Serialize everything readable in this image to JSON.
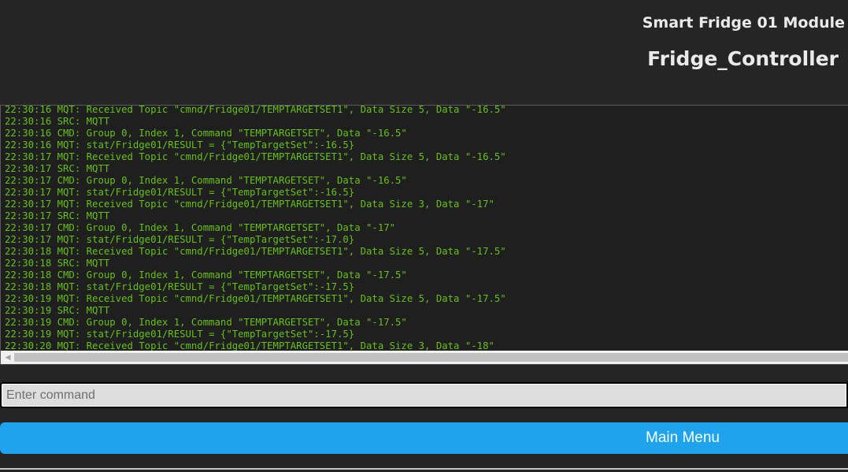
{
  "header": {
    "module_name": "Smart Fridge 01 Module",
    "device_name": "Fridge_Controller"
  },
  "console": {
    "lines": [
      "22:30:16 MQT: Received Topic \"cmnd/Fridge01/TEMPTARGETSET1\", Data Size 5, Data \"-16.5\"",
      "22:30:16 SRC: MQTT",
      "22:30:16 CMD: Group 0, Index 1, Command \"TEMPTARGETSET\", Data \"-16.5\"",
      "22:30:16 MQT: stat/Fridge01/RESULT = {\"TempTargetSet\":-16.5}",
      "22:30:17 MQT: Received Topic \"cmnd/Fridge01/TEMPTARGETSET1\", Data Size 5, Data \"-16.5\"",
      "22:30:17 SRC: MQTT",
      "22:30:17 CMD: Group 0, Index 1, Command \"TEMPTARGETSET\", Data \"-16.5\"",
      "22:30:17 MQT: stat/Fridge01/RESULT = {\"TempTargetSet\":-16.5}",
      "22:30:17 MQT: Received Topic \"cmnd/Fridge01/TEMPTARGETSET1\", Data Size 3, Data \"-17\"",
      "22:30:17 SRC: MQTT",
      "22:30:17 CMD: Group 0, Index 1, Command \"TEMPTARGETSET\", Data \"-17\"",
      "22:30:17 MQT: stat/Fridge01/RESULT = {\"TempTargetSet\":-17.0}",
      "22:30:18 MQT: Received Topic \"cmnd/Fridge01/TEMPTARGETSET1\", Data Size 5, Data \"-17.5\"",
      "22:30:18 SRC: MQTT",
      "22:30:18 CMD: Group 0, Index 1, Command \"TEMPTARGETSET\", Data \"-17.5\"",
      "22:30:18 MQT: stat/Fridge01/RESULT = {\"TempTargetSet\":-17.5}",
      "22:30:19 MQT: Received Topic \"cmnd/Fridge01/TEMPTARGETSET1\", Data Size 5, Data \"-17.5\"",
      "22:30:19 SRC: MQTT",
      "22:30:19 CMD: Group 0, Index 1, Command \"TEMPTARGETSET\", Data \"-17.5\"",
      "22:30:19 MQT: stat/Fridge01/RESULT = {\"TempTargetSet\":-17.5}",
      "22:30:20 MQT: Received Topic \"cmnd/Fridge01/TEMPTARGETSET1\", Data Size 3, Data \"-18\""
    ]
  },
  "command": {
    "placeholder": "Enter command",
    "value": ""
  },
  "buttons": {
    "main_menu_label": "Main Menu"
  },
  "colors": {
    "background": "#252525",
    "console_text": "#65c115",
    "button": "#1fa3ec",
    "header_text": "#eaeaea"
  },
  "icons": {
    "scroll_left": "scroll-left-arrow-icon"
  }
}
